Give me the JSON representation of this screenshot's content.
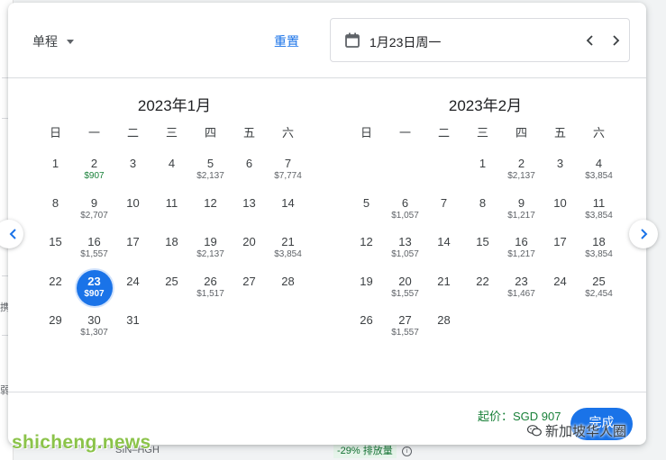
{
  "background": {
    "left_fragments": [
      "携",
      "弱"
    ],
    "route": "SIN–HGH",
    "emission_chip": "-29% 排放量",
    "info_icon": "info-icon"
  },
  "header": {
    "trip_type": "单程",
    "reset_label": "重置",
    "date_value": "1月23日周一",
    "calendar_icon": "calendar-icon",
    "prev_icon": "chevron-left-icon",
    "next_icon": "chevron-right-icon"
  },
  "weekdays": [
    "日",
    "一",
    "二",
    "三",
    "四",
    "五",
    "六"
  ],
  "months": [
    {
      "title": "2023年1月",
      "offset": 0,
      "days": [
        {
          "d": "1",
          "p": ""
        },
        {
          "d": "2",
          "p": "$907",
          "low": true
        },
        {
          "d": "3",
          "p": ""
        },
        {
          "d": "4",
          "p": ""
        },
        {
          "d": "5",
          "p": "$2,137"
        },
        {
          "d": "6",
          "p": ""
        },
        {
          "d": "7",
          "p": "$7,774"
        },
        {
          "d": "8",
          "p": ""
        },
        {
          "d": "9",
          "p": "$2,707"
        },
        {
          "d": "10",
          "p": ""
        },
        {
          "d": "11",
          "p": ""
        },
        {
          "d": "12",
          "p": ""
        },
        {
          "d": "13",
          "p": ""
        },
        {
          "d": "14",
          "p": ""
        },
        {
          "d": "15",
          "p": ""
        },
        {
          "d": "16",
          "p": "$1,557"
        },
        {
          "d": "17",
          "p": ""
        },
        {
          "d": "18",
          "p": ""
        },
        {
          "d": "19",
          "p": "$2,137"
        },
        {
          "d": "20",
          "p": ""
        },
        {
          "d": "21",
          "p": "$3,854"
        },
        {
          "d": "22",
          "p": ""
        },
        {
          "d": "23",
          "p": "$907",
          "selected": true
        },
        {
          "d": "24",
          "p": ""
        },
        {
          "d": "25",
          "p": ""
        },
        {
          "d": "26",
          "p": "$1,517"
        },
        {
          "d": "27",
          "p": ""
        },
        {
          "d": "28",
          "p": ""
        },
        {
          "d": "29",
          "p": ""
        },
        {
          "d": "30",
          "p": "$1,307"
        },
        {
          "d": "31",
          "p": ""
        }
      ]
    },
    {
      "title": "2023年2月",
      "offset": 3,
      "days": [
        {
          "d": "1",
          "p": ""
        },
        {
          "d": "2",
          "p": "$2,137"
        },
        {
          "d": "3",
          "p": ""
        },
        {
          "d": "4",
          "p": "$3,854"
        },
        {
          "d": "5",
          "p": ""
        },
        {
          "d": "6",
          "p": "$1,057"
        },
        {
          "d": "7",
          "p": ""
        },
        {
          "d": "8",
          "p": ""
        },
        {
          "d": "9",
          "p": "$1,217"
        },
        {
          "d": "10",
          "p": ""
        },
        {
          "d": "11",
          "p": "$3,854"
        },
        {
          "d": "12",
          "p": ""
        },
        {
          "d": "13",
          "p": "$1,057"
        },
        {
          "d": "14",
          "p": ""
        },
        {
          "d": "15",
          "p": ""
        },
        {
          "d": "16",
          "p": "$1,217"
        },
        {
          "d": "17",
          "p": ""
        },
        {
          "d": "18",
          "p": "$3,854"
        },
        {
          "d": "19",
          "p": ""
        },
        {
          "d": "20",
          "p": "$1,557"
        },
        {
          "d": "21",
          "p": ""
        },
        {
          "d": "22",
          "p": ""
        },
        {
          "d": "23",
          "p": "$1,467"
        },
        {
          "d": "24",
          "p": ""
        },
        {
          "d": "25",
          "p": "$2,454"
        },
        {
          "d": "26",
          "p": ""
        },
        {
          "d": "27",
          "p": "$1,557"
        },
        {
          "d": "28",
          "p": ""
        }
      ]
    }
  ],
  "nav": {
    "prev_month_icon": "chevron-left-icon",
    "next_month_icon": "chevron-right-icon"
  },
  "footer": {
    "lowest_price": "起价：SGD 907",
    "done_label": "完成"
  },
  "watermarks": {
    "left": "shicheng.news",
    "right": "新加坡华人圈",
    "right_icon": "wechat-icon"
  },
  "colors": {
    "accent": "#1a73e8",
    "low_price": "#188038"
  }
}
